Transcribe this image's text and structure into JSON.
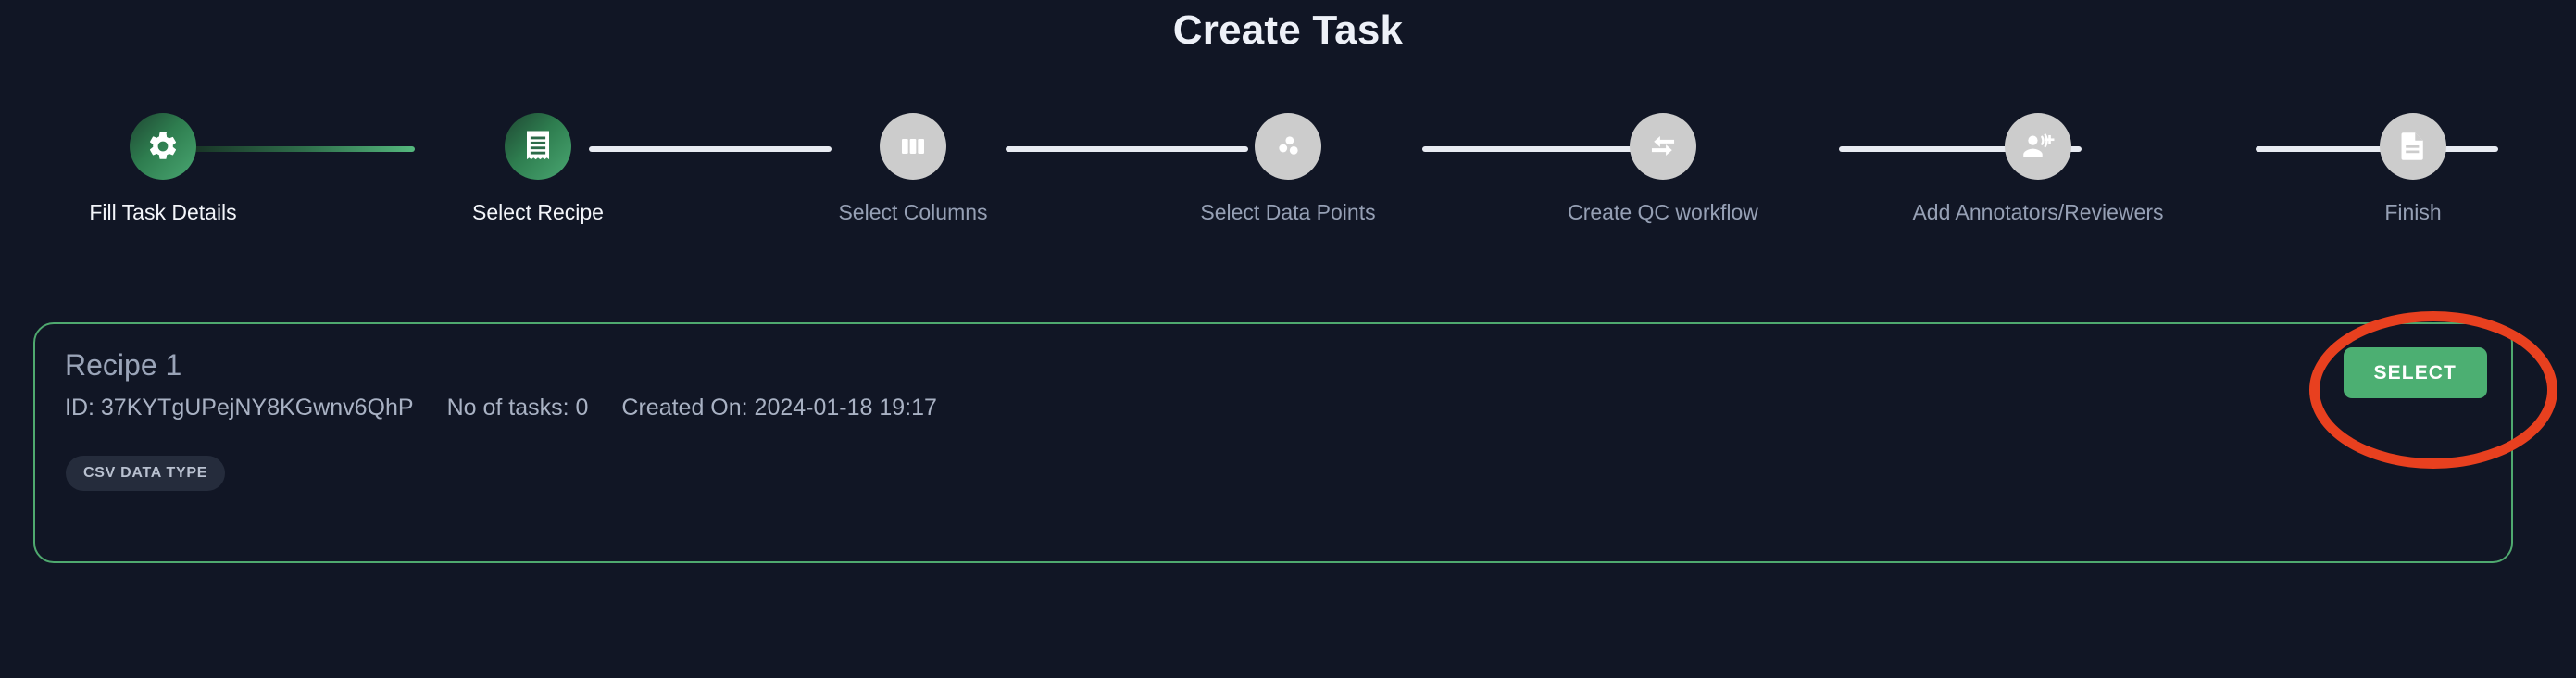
{
  "header": {
    "title": "Create Task"
  },
  "stepper": {
    "steps": [
      {
        "label": "Fill Task Details",
        "icon": "gear-icon",
        "state": "done"
      },
      {
        "label": "Select Recipe",
        "icon": "receipt-icon",
        "state": "done"
      },
      {
        "label": "Select Columns",
        "icon": "columns-icon",
        "state": "pending"
      },
      {
        "label": "Select Data Points",
        "icon": "scatter-dots-icon",
        "state": "pending"
      },
      {
        "label": "Create QC workflow",
        "icon": "compare-arrows-icon",
        "state": "pending"
      },
      {
        "label": "Add Annotators/Reviewers",
        "icon": "person-add-icon",
        "state": "pending"
      },
      {
        "label": "Finish",
        "icon": "document-icon",
        "state": "pending"
      }
    ]
  },
  "recipe_card": {
    "title": "Recipe 1",
    "id_text": "ID: 37KYTgUPejNY8KGwnv6QhP",
    "tasks_text": "No of tasks: 0",
    "created_text": "Created On: 2024-01-18 19:17",
    "chip_label": "CSV DATA TYPE",
    "select_label": "SELECT"
  },
  "colors": {
    "background": "#111625",
    "accent_green": "#4caf72",
    "card_border": "#4fa96f",
    "annotation_red": "#e8401f",
    "step_inactive": "#cccccc",
    "label_inactive": "#96a0b5",
    "label_active": "#f3f5fa",
    "chip_background": "#252c3c"
  }
}
